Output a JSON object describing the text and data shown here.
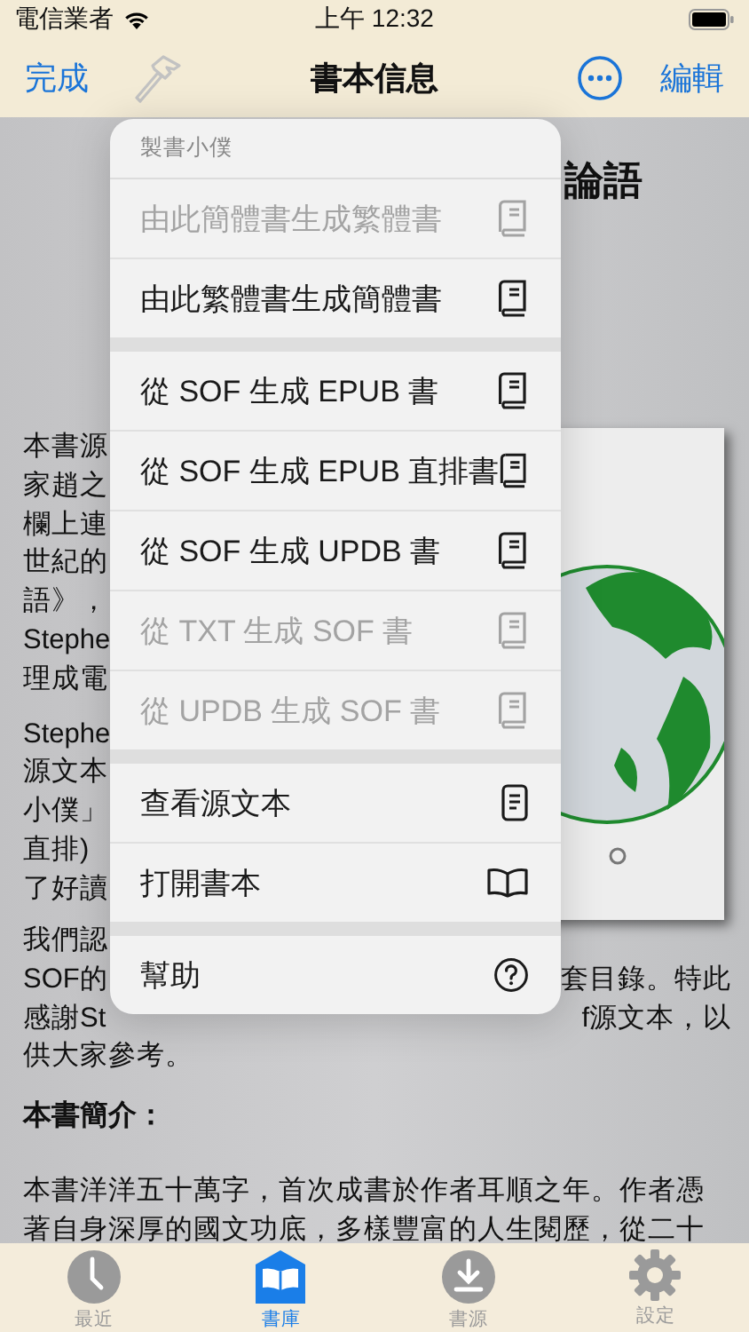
{
  "status_bar": {
    "carrier": "電信業者",
    "time": "上午 12:32"
  },
  "nav": {
    "done": "完成",
    "title": "書本信息",
    "edit": "編輯"
  },
  "article": {
    "title": "論語",
    "top_blocks": [
      {
        "lines": [
          "本書源",
          "家趙之",
          "欄上連",
          "世紀的",
          "語》，",
          "Stephe",
          "理成電"
        ]
      },
      {
        "lines": [
          "Stephe",
          "源文本",
          "小僕」",
          "直排)",
          "了好讀"
        ]
      }
    ],
    "lines": [
      {
        "left": "我們認"
      },
      {
        "left": "SOF的",
        "right": "套目錄。特此"
      },
      {
        "left": "感謝St",
        "right": "f源文本，以"
      },
      {
        "left": "供大家參考。"
      }
    ],
    "heading": "本書簡介：",
    "paragraph": [
      "本書洋洋五十萬字，首次成書於作者耳順之年。作者憑",
      "著自身深厚的國文功底，多樣豐富的人生閱歷，從二十"
    ]
  },
  "menu": {
    "title": "製書小僕",
    "sections": [
      {
        "items": [
          {
            "label": "由此簡體書生成繁體書",
            "kind": "book",
            "disabled": true
          },
          {
            "label": "由此繁體書生成簡體書",
            "kind": "book",
            "disabled": false
          }
        ]
      },
      {
        "items": [
          {
            "label": "從 SOF 生成 EPUB 書",
            "kind": "book",
            "disabled": false
          },
          {
            "label": "從 SOF 生成 EPUB 直排書",
            "kind": "book",
            "disabled": false
          },
          {
            "label": "從 SOF 生成 UPDB 書",
            "kind": "book",
            "disabled": false
          },
          {
            "label": "從 TXT 生成 SOF 書",
            "kind": "book",
            "disabled": true
          },
          {
            "label": "從 UPDB 生成 SOF 書",
            "kind": "book",
            "disabled": true
          }
        ]
      },
      {
        "items": [
          {
            "label": "查看源文本",
            "kind": "document",
            "disabled": false
          },
          {
            "label": "打開書本",
            "kind": "open-book",
            "disabled": false
          }
        ]
      },
      {
        "items": [
          {
            "label": "幫助",
            "kind": "help",
            "disabled": false
          }
        ]
      }
    ]
  },
  "tabs": [
    {
      "label": "最近",
      "kind": "clock",
      "selected": false
    },
    {
      "label": "書庫",
      "kind": "library",
      "selected": true
    },
    {
      "label": "書源",
      "kind": "download",
      "selected": false
    },
    {
      "label": "設定",
      "kind": "gear",
      "selected": false
    }
  ]
}
